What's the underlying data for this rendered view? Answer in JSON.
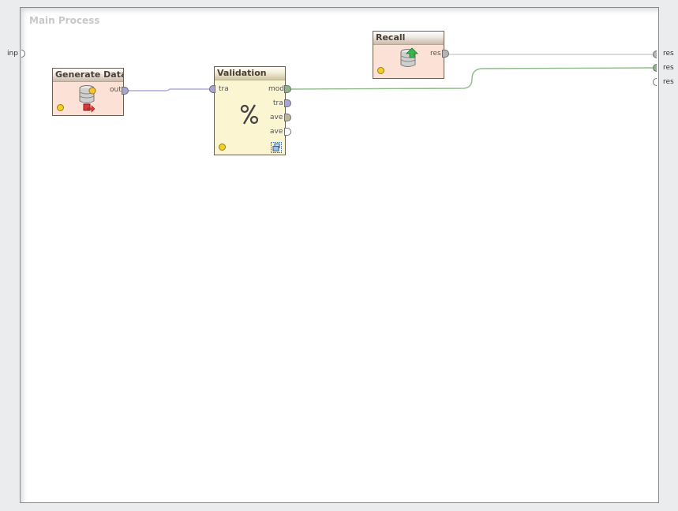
{
  "process": {
    "title": "Main Process"
  },
  "inputs": [
    {
      "label": "inp"
    }
  ],
  "outputs": [
    {
      "label": "res"
    },
    {
      "label": "res"
    },
    {
      "label": "res"
    }
  ],
  "operators": {
    "generate_data": {
      "title": "Generate Data",
      "ports_out": [
        "out"
      ],
      "icon": "database-generate-icon"
    },
    "validation": {
      "title": "Validation",
      "ports_in": [
        "tra"
      ],
      "ports_out": [
        "mod",
        "tra",
        "ave",
        "ave"
      ],
      "icon": "percent-icon",
      "subprocess_icon": "subprocess-icon"
    },
    "recall": {
      "title": "Recall",
      "ports_out": [
        "res"
      ],
      "icon": "database-recall-icon"
    }
  },
  "colors": {
    "example_set_port": "#a9a3d6",
    "model_port": "#8fb48a",
    "performance_port": "#bcb69a",
    "generic_port": "#b5b5b5",
    "example_wire": "#9a9ad2",
    "model_wire": "#8fbb8a",
    "generic_wire": "#b8b8b8"
  }
}
